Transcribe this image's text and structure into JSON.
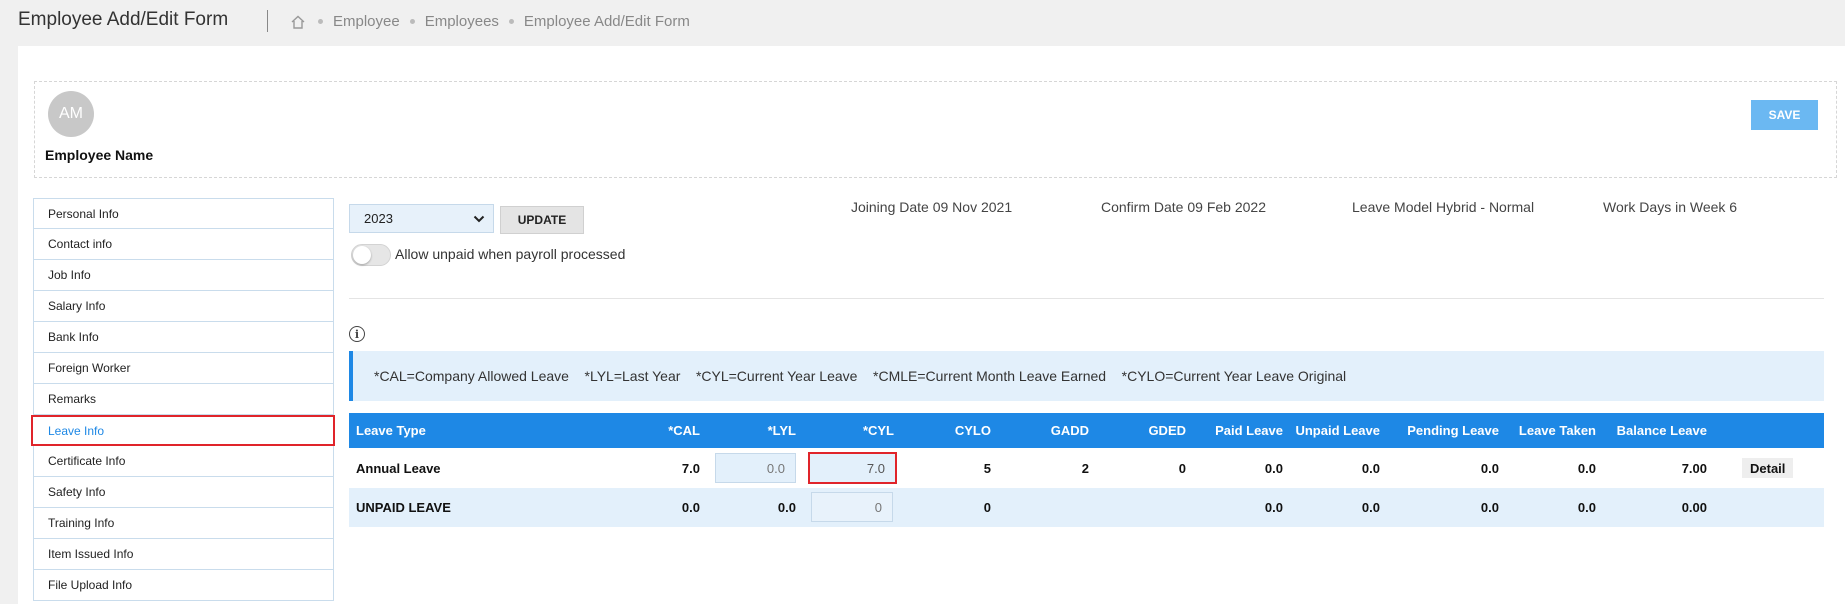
{
  "header": {
    "title": "Employee Add/Edit Form",
    "breadcrumb": [
      "Employee",
      "Employees",
      "Employee Add/Edit Form"
    ]
  },
  "employee": {
    "initials": "AM",
    "name": "Employee Name",
    "save_label": "SAVE"
  },
  "sidebar": {
    "items": [
      {
        "label": "Personal Info"
      },
      {
        "label": "Contact info"
      },
      {
        "label": "Job Info"
      },
      {
        "label": "Salary Info"
      },
      {
        "label": "Bank Info"
      },
      {
        "label": "Foreign Worker"
      },
      {
        "label": "Remarks"
      },
      {
        "label": "Leave Info",
        "active": true
      },
      {
        "label": "Certificate Info"
      },
      {
        "label": "Safety Info"
      },
      {
        "label": "Training Info"
      },
      {
        "label": "Item Issued Info"
      },
      {
        "label": "File Upload Info"
      }
    ]
  },
  "controls": {
    "year": "2023",
    "update_label": "UPDATE",
    "toggle_label": "Allow unpaid when payroll processed"
  },
  "info": {
    "joining": "Joining Date 09 Nov 2021",
    "confirm": "Confirm Date 09 Feb 2022",
    "model": "Leave Model Hybrid - Normal",
    "workdays": "Work Days in Week 6"
  },
  "legend": "*CAL=Company Allowed Leave    *LYL=Last Year    *CYL=Current Year Leave    *CMLE=Current Month Leave Earned    *CYLO=Current Year Leave Original",
  "table": {
    "headers": [
      "Leave Type",
      "*CAL",
      "*LYL",
      "*CYL",
      "CYLO",
      "GADD",
      "GDED",
      "Paid Leave",
      "Unpaid Leave",
      "Pending Leave",
      "Leave Taken",
      "Balance Leave"
    ],
    "rows": [
      {
        "type": "Annual Leave",
        "cal": "7.0",
        "lyl": "0.0",
        "cyl": "7.0",
        "cylo": "5",
        "gadd": "2",
        "gded": "0",
        "paid": "0.0",
        "unpaid": "0.0",
        "pending": "0.0",
        "taken": "0.0",
        "balance": "7.00",
        "detail": "Detail"
      },
      {
        "type": "UNPAID LEAVE",
        "cal": "0.0",
        "lyl": "0.0",
        "cyl": "0",
        "cylo": "0",
        "gadd": "",
        "gded": "",
        "paid": "0.0",
        "unpaid": "0.0",
        "pending": "0.0",
        "taken": "0.0",
        "balance": "0.00",
        "detail": ""
      }
    ]
  }
}
